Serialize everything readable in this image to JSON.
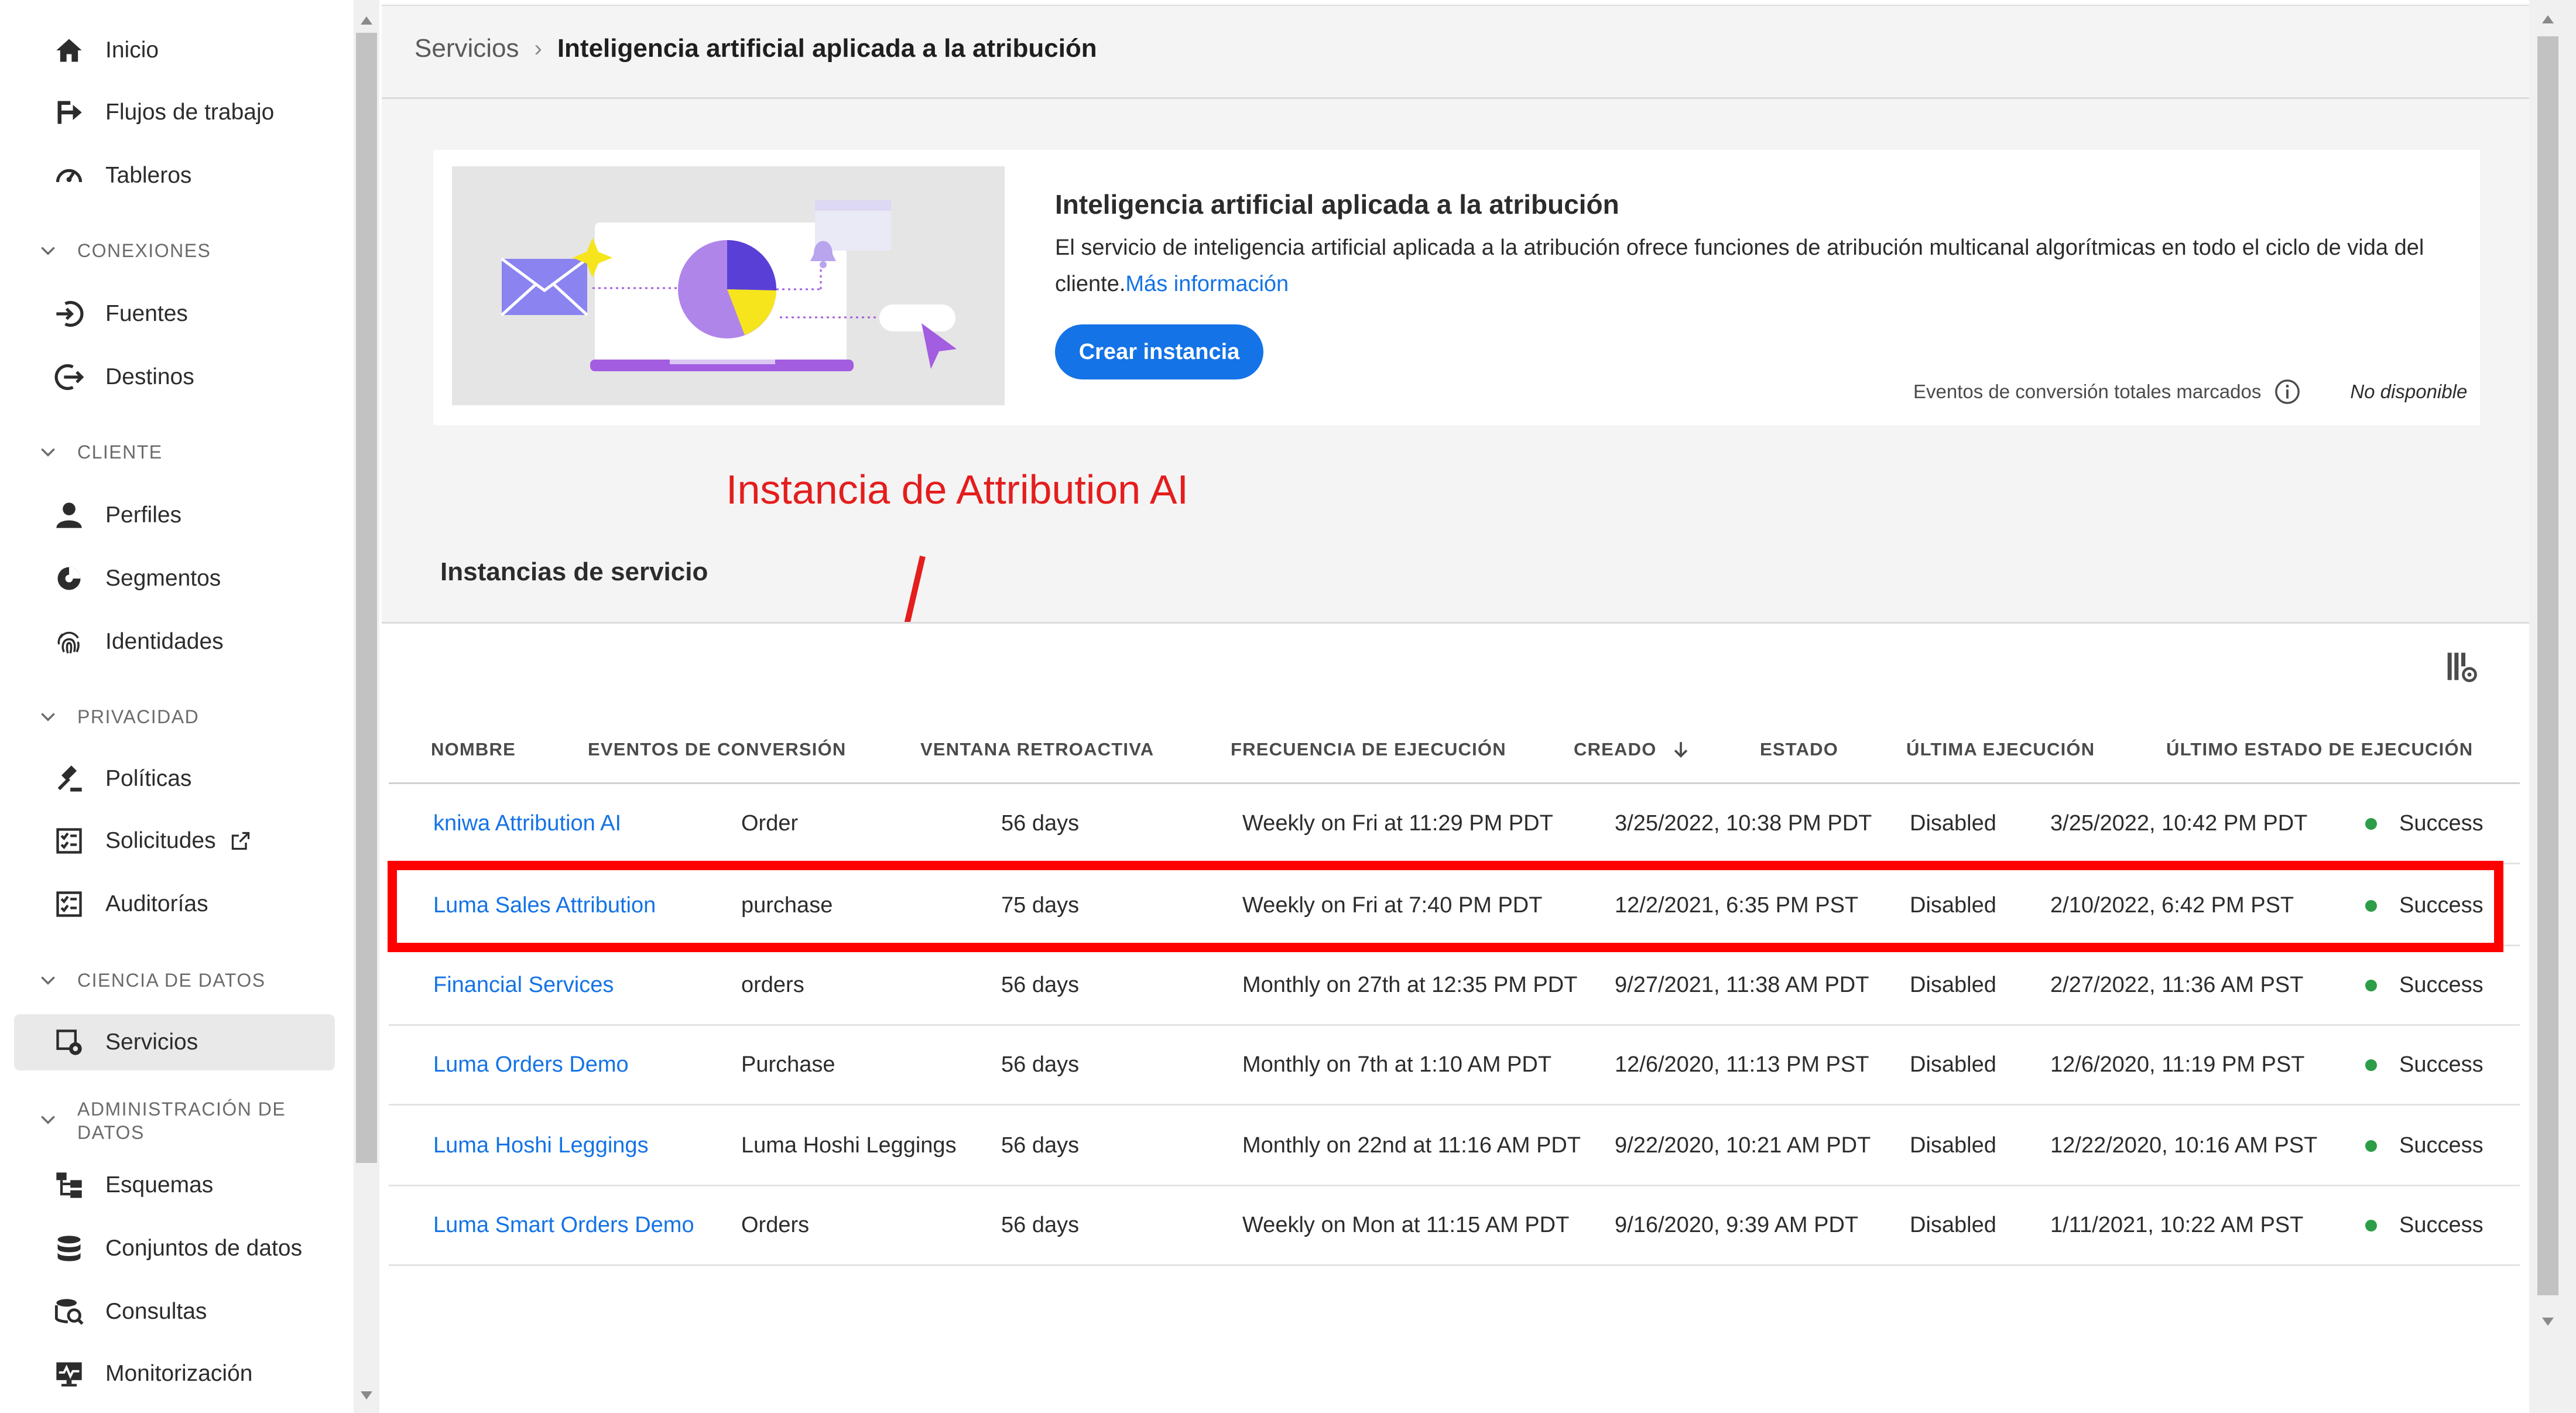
{
  "sidebar": {
    "items": {
      "inicio": "Inicio",
      "flujos": "Flujos de trabajo",
      "tableros": "Tableros",
      "fuentes": "Fuentes",
      "destinos": "Destinos",
      "perfiles": "Perfiles",
      "segmentos": "Segmentos",
      "identidades": "Identidades",
      "politicas": "Políticas",
      "solicitudes": "Solicitudes",
      "auditorias": "Auditorías",
      "servicios": "Servicios",
      "esquemas": "Esquemas",
      "conjuntos": "Conjuntos de datos",
      "consultas": "Consultas",
      "monitorizacion": "Monitorización"
    },
    "sections": {
      "conexiones": "CONEXIONES",
      "cliente": "CLIENTE",
      "privacidad": "PRIVACIDAD",
      "ciencia": "CIENCIA DE DATOS",
      "admin_line1": "ADMINISTRACIÓN DE",
      "admin_line2": "DATOS"
    },
    "active_item": "Servicios"
  },
  "breadcrumb": {
    "parent": "Servicios",
    "current": "Inteligencia artificial aplicada a la atribución"
  },
  "service_card": {
    "title": "Inteligencia artificial aplicada a la atribución",
    "description": "El servicio de inteligencia artificial aplicada a la atribución ofrece funciones de atribución multicanal algorítmicas en todo el ciclo de vida del cliente.",
    "learn_more": "Más información",
    "create_button": "Crear instancia",
    "conversion_label": "Eventos de conversión totales marcados",
    "conversion_value": "No disponible"
  },
  "annotation": {
    "label": "Instancia de Attribution AI",
    "color": "#e41d1d"
  },
  "instances": {
    "title": "Instancias de servicio",
    "columns": {
      "nombre": "NOMBRE",
      "eventos": "EVENTOS DE CONVERSIÓN",
      "ventana": "VENTANA RETROACTIVA",
      "frecuencia": "FRECUENCIA DE EJECUCIÓN",
      "creado": "CREADO",
      "estado": "ESTADO",
      "ultima": "ÚLTIMA EJECUCIÓN",
      "ultimo_estado": "ÚLTIMO ESTADO DE EJECUCIÓN"
    },
    "sort_column": "CREADO",
    "sort_direction": "descending",
    "rows": [
      {
        "name": "kniwa Attribution AI",
        "event": "Order",
        "window": "56 days",
        "frequency": "Weekly on Fri at 11:29 PM PDT",
        "created": "3/25/2022, 10:38 PM PDT",
        "state": "Disabled",
        "last_run": "3/25/2022, 10:42 PM PDT",
        "last_status": "Success"
      },
      {
        "name": "Luma Sales Attribution",
        "event": "purchase",
        "window": "75 days",
        "frequency": "Weekly on Fri at 7:40 PM PDT",
        "created": "12/2/2021, 6:35 PM PST",
        "state": "Disabled",
        "last_run": "2/10/2022, 6:42 PM PST",
        "last_status": "Success"
      },
      {
        "name": "Financial Services",
        "event": "orders",
        "window": "56 days",
        "frequency": "Monthly on 27th at 12:35 PM PDT",
        "created": "9/27/2021, 11:38 AM PDT",
        "state": "Disabled",
        "last_run": "2/27/2022, 11:36 AM PST",
        "last_status": "Success"
      },
      {
        "name": "Luma Orders Demo",
        "event": "Purchase",
        "window": "56 days",
        "frequency": "Monthly on 7th at 1:10 AM PDT",
        "created": "12/6/2020, 11:13 PM PST",
        "state": "Disabled",
        "last_run": "12/6/2020, 11:19 PM PST",
        "last_status": "Success"
      },
      {
        "name": "Luma Hoshi Leggings",
        "event": "Luma Hoshi Leggings",
        "window": "56 days",
        "frequency": "Monthly on 22nd at 11:16 AM PDT",
        "created": "9/22/2020, 10:21 AM PDT",
        "state": "Disabled",
        "last_run": "12/22/2020, 10:16 AM PST",
        "last_status": "Success"
      },
      {
        "name": "Luma Smart Orders Demo",
        "event": "Orders",
        "window": "56 days",
        "frequency": "Weekly on Mon at 11:15 AM PDT",
        "created": "9/16/2020, 9:39 AM PDT",
        "state": "Disabled",
        "last_run": "1/11/2021, 10:22 AM PST",
        "last_status": "Success"
      }
    ],
    "highlighted_row": "Luma Sales Attribution"
  },
  "colors": {
    "link": "#1473e6",
    "primary_button": "#1473e6",
    "success_dot": "#2d9d48",
    "highlight_box": "#ff0000"
  }
}
